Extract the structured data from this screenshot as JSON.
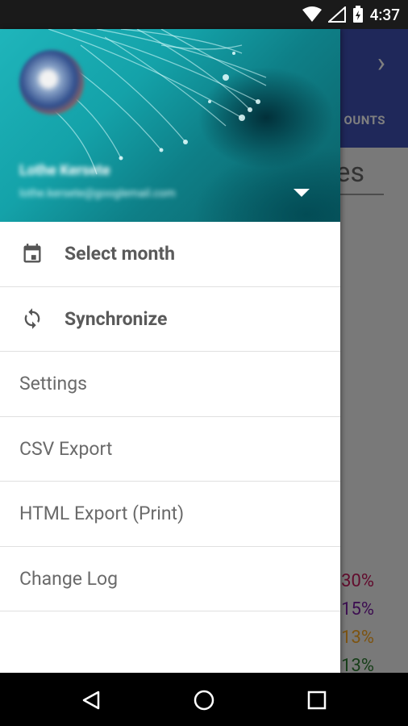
{
  "status_bar": {
    "time": "4:37",
    "icons": [
      "wifi-icon",
      "signal-icon",
      "battery-charging-icon"
    ]
  },
  "background_app": {
    "header_tab_partial": "OUNTS",
    "title_partial": "es",
    "percentages": [
      {
        "text": "30%",
        "color": "#c2185b"
      },
      {
        "text": "15%",
        "color": "#7b1fa2"
      },
      {
        "text": "13%",
        "color": "#f9a825"
      },
      {
        "text": "13%",
        "color": "#2e7d32"
      }
    ]
  },
  "drawer": {
    "account": {
      "name": "Lothe Kersete",
      "email": "lothe.kersete@googlemail.com"
    },
    "menu": [
      {
        "label": "Select month",
        "icon": "calendar-icon",
        "style": "primary"
      },
      {
        "label": "Synchronize",
        "icon": "sync-icon",
        "style": "primary"
      },
      {
        "label": "Settings",
        "style": "plain"
      },
      {
        "label": "CSV Export",
        "style": "plain"
      },
      {
        "label": "HTML Export (Print)",
        "style": "plain"
      },
      {
        "label": "Change Log",
        "style": "plain"
      }
    ]
  },
  "nav_bar": {
    "buttons": [
      "back-icon",
      "home-icon",
      "recents-icon"
    ]
  },
  "colors": {
    "app_primary": "#3f51b5",
    "drawer_header": "#14a2a9"
  }
}
